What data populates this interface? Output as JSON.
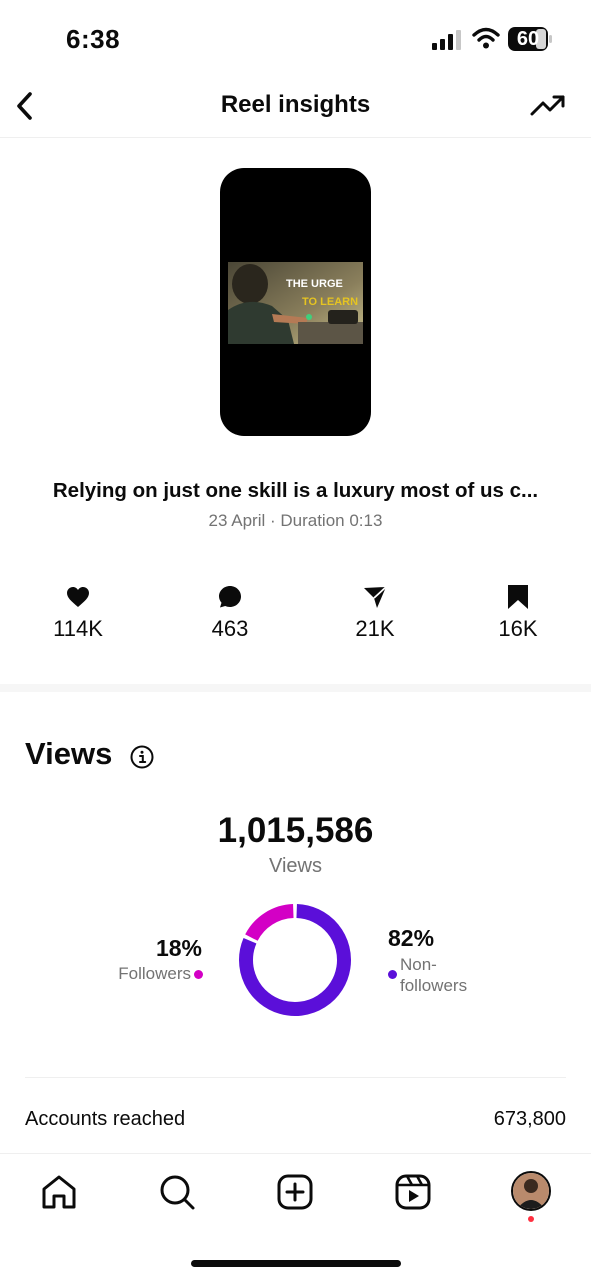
{
  "status_bar": {
    "time": "6:38",
    "battery": "60",
    "icons": [
      "signal-icon",
      "wifi-icon",
      "battery-icon"
    ]
  },
  "header": {
    "title": "Reel insights",
    "back_icon": "chevron-left-icon",
    "trend_icon": "trending-up-icon"
  },
  "reel": {
    "thumbnail_text_line1": "THE URGE",
    "thumbnail_text_line2": "TO LEARN",
    "caption": "Relying on just one skill is a luxury most of us c...",
    "meta": "23 April · Duration 0:13"
  },
  "engagement": [
    {
      "icon": "heart-icon",
      "value": "114K"
    },
    {
      "icon": "comment-icon",
      "value": "463"
    },
    {
      "icon": "share-icon",
      "value": "21K"
    },
    {
      "icon": "bookmark-icon",
      "value": "16K"
    }
  ],
  "views": {
    "heading": "Views",
    "total": "1,015,586",
    "label": "Views",
    "followers_pct": "18%",
    "followers_label": "Followers",
    "nonfollowers_pct": "82%",
    "nonfollowers_label": "Non-followers",
    "followers_share": 0.18,
    "colors": {
      "followers": "#d300c5",
      "nonfollowers": "#5b0fd9"
    }
  },
  "accounts_reached": {
    "label": "Accounts reached",
    "value": "673,800"
  },
  "bottom_nav": [
    "home-icon",
    "search-icon",
    "create-icon",
    "reels-icon",
    "profile-avatar"
  ]
}
